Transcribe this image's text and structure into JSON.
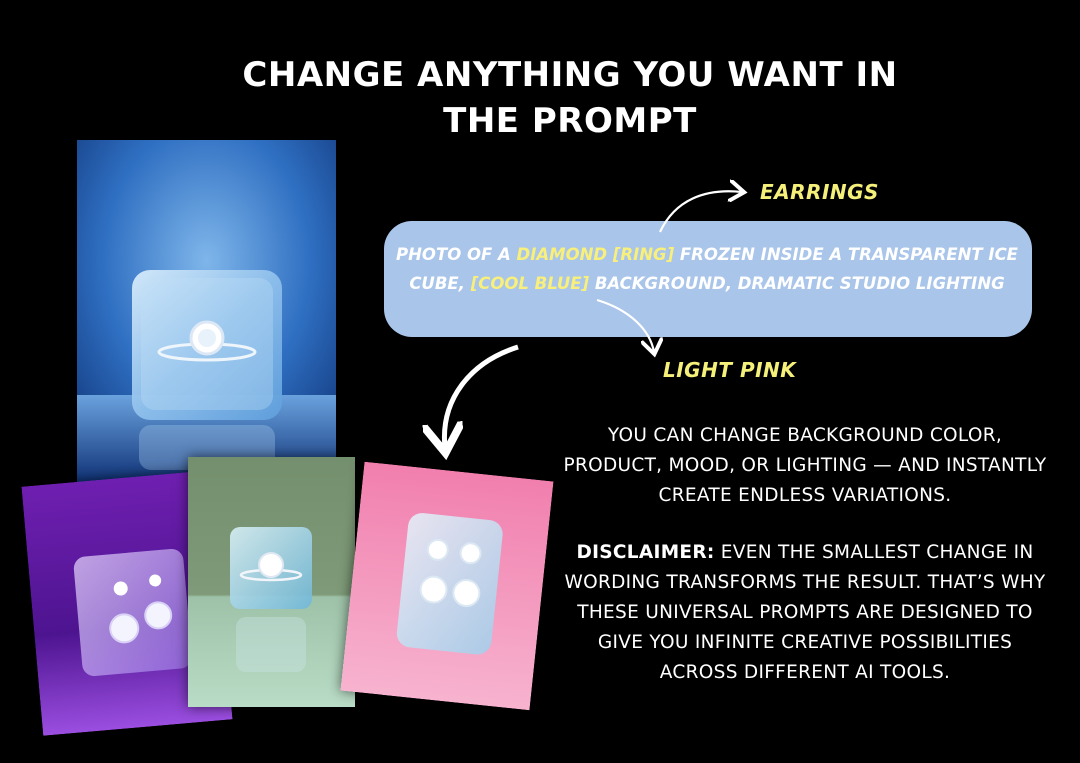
{
  "title": {
    "line1": "CHANGE ANYTHING YOU WANT IN",
    "line2": "THE PROMPT"
  },
  "prompt": {
    "part1": "PHOTO OF A ",
    "highlight1": "DIAMOND [RING]",
    "part2": " FROZEN INSIDE A TRANSPARENT ICE CUBE, ",
    "highlight2": "[COOL BLUE]",
    "part3": " BACKGROUND, DRAMATIC STUDIO LIGHTING"
  },
  "alternatives": {
    "ring_alt": "EARRINGS",
    "color_alt": "LIGHT PINK"
  },
  "info": {
    "paragraph1": "YOU CAN CHANGE BACKGROUND COLOR, PRODUCT, MOOD, OR LIGHTING — AND INSTANTLY CREATE ENDLESS VARIATIONS.",
    "disclaimer_label": "DISCLAIMER:",
    "disclaimer_text": " EVEN THE SMALLEST CHANGE IN WORDING TRANSFORMS THE RESULT. THAT’S WHY THESE UNIVERSAL PROMPTS ARE DESIGNED TO GIVE YOU INFINITE CREATIVE POSSIBILITIES ACROSS DIFFERENT AI TOOLS."
  },
  "colors": {
    "background": "#000000",
    "pill": "#a9c5ea",
    "highlight": "#f8f07a",
    "text": "#ffffff"
  },
  "images": [
    {
      "name": "blue-ring-ice-photo",
      "background": "cool blue"
    },
    {
      "name": "purple-earrings-ice-photo",
      "background": "purple"
    },
    {
      "name": "green-ring-ice-photo",
      "background": "sage green"
    },
    {
      "name": "pink-earrings-ice-photo",
      "background": "light pink"
    }
  ]
}
